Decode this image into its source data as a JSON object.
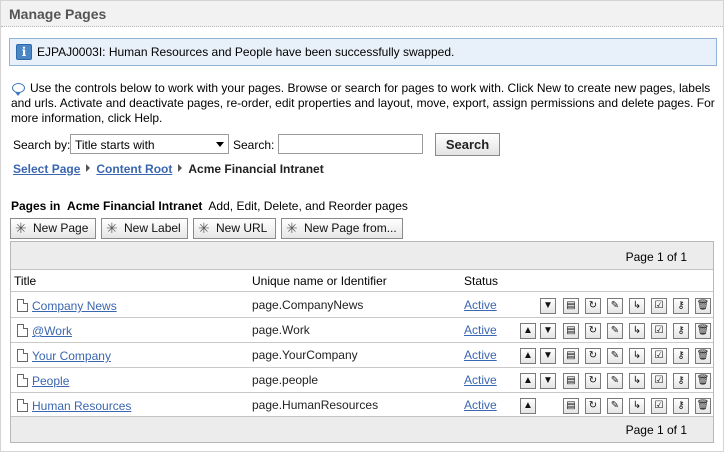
{
  "title": "Manage Pages",
  "message": {
    "icon": "info-icon",
    "icon_glyph": "i",
    "text": "EJPAJ0003I: Human Resources and People have been successfully swapped."
  },
  "help_text": "Use the controls below to work with your pages. Browse or search for pages to work with. Click New to create new pages, labels and urls. Activate and deactivate pages, re-order, edit properties and layout, move, export, assign permissions and delete pages. For more information, click Help.",
  "search": {
    "by_label": "Search by:",
    "by_value": "Title starts with",
    "label": "Search:",
    "value": "",
    "button": "Search"
  },
  "breadcrumb": {
    "items": [
      "Select Page",
      "Content Root"
    ],
    "current": "Acme Financial Intranet"
  },
  "pages_in": {
    "prefix": "Pages in",
    "name": "Acme Financial Intranet",
    "suffix": "Add, Edit, Delete, and Reorder pages"
  },
  "toolbar": {
    "new_page": "New Page",
    "new_label": "New Label",
    "new_url": "New URL",
    "new_page_from": "New Page from..."
  },
  "pager": "Page 1 of 1",
  "columns": [
    "Title",
    "Unique name or Identifier",
    "Status"
  ],
  "rows": [
    {
      "title": "Company News",
      "uid": "page.CompanyNews",
      "status": "Active",
      "up": false,
      "down": true
    },
    {
      "title": "@Work",
      "uid": "page.Work",
      "status": "Active",
      "up": true,
      "down": true
    },
    {
      "title": "Your Company",
      "uid": "page.YourCompany",
      "status": "Active",
      "up": true,
      "down": true
    },
    {
      "title": "People",
      "uid": "page.people",
      "status": "Active",
      "up": true,
      "down": true
    },
    {
      "title": "Human Resources",
      "uid": "page.HumanResources",
      "status": "Active",
      "up": true,
      "down": false
    }
  ],
  "action_icons": [
    {
      "name": "move-up-icon",
      "glyph": "▲"
    },
    {
      "name": "move-down-icon",
      "glyph": "▼"
    },
    {
      "name": "properties-icon",
      "glyph": "▤"
    },
    {
      "name": "refresh-icon",
      "glyph": "↻"
    },
    {
      "name": "edit-layout-icon",
      "glyph": "✎"
    },
    {
      "name": "move-page-icon",
      "glyph": "↳"
    },
    {
      "name": "export-icon",
      "glyph": "☑"
    },
    {
      "name": "permissions-key-icon",
      "glyph": "⚷"
    },
    {
      "name": "delete-trash-icon",
      "glyph": "🗑"
    }
  ]
}
